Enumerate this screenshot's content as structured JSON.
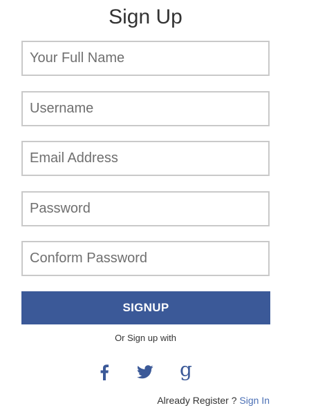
{
  "form": {
    "title": "Sign Up",
    "fields": [
      {
        "placeholder": "Your Full Name",
        "value": ""
      },
      {
        "placeholder": "Username",
        "value": ""
      },
      {
        "placeholder": "Email Address",
        "value": ""
      },
      {
        "placeholder": "Password",
        "value": ""
      },
      {
        "placeholder": "Conform Password",
        "value": ""
      }
    ],
    "submit_label": "SIGNUP",
    "social_prompt": "Or Sign up with",
    "social": {
      "facebook_icon": "facebook-icon",
      "twitter_icon": "twitter-icon",
      "google_glyph": "g"
    },
    "footer": {
      "text": "Already Register ? ",
      "link": "Sign In"
    }
  },
  "colors": {
    "accent": "#3b5998",
    "link": "#4a6fb5",
    "border": "#c9c9c9"
  }
}
